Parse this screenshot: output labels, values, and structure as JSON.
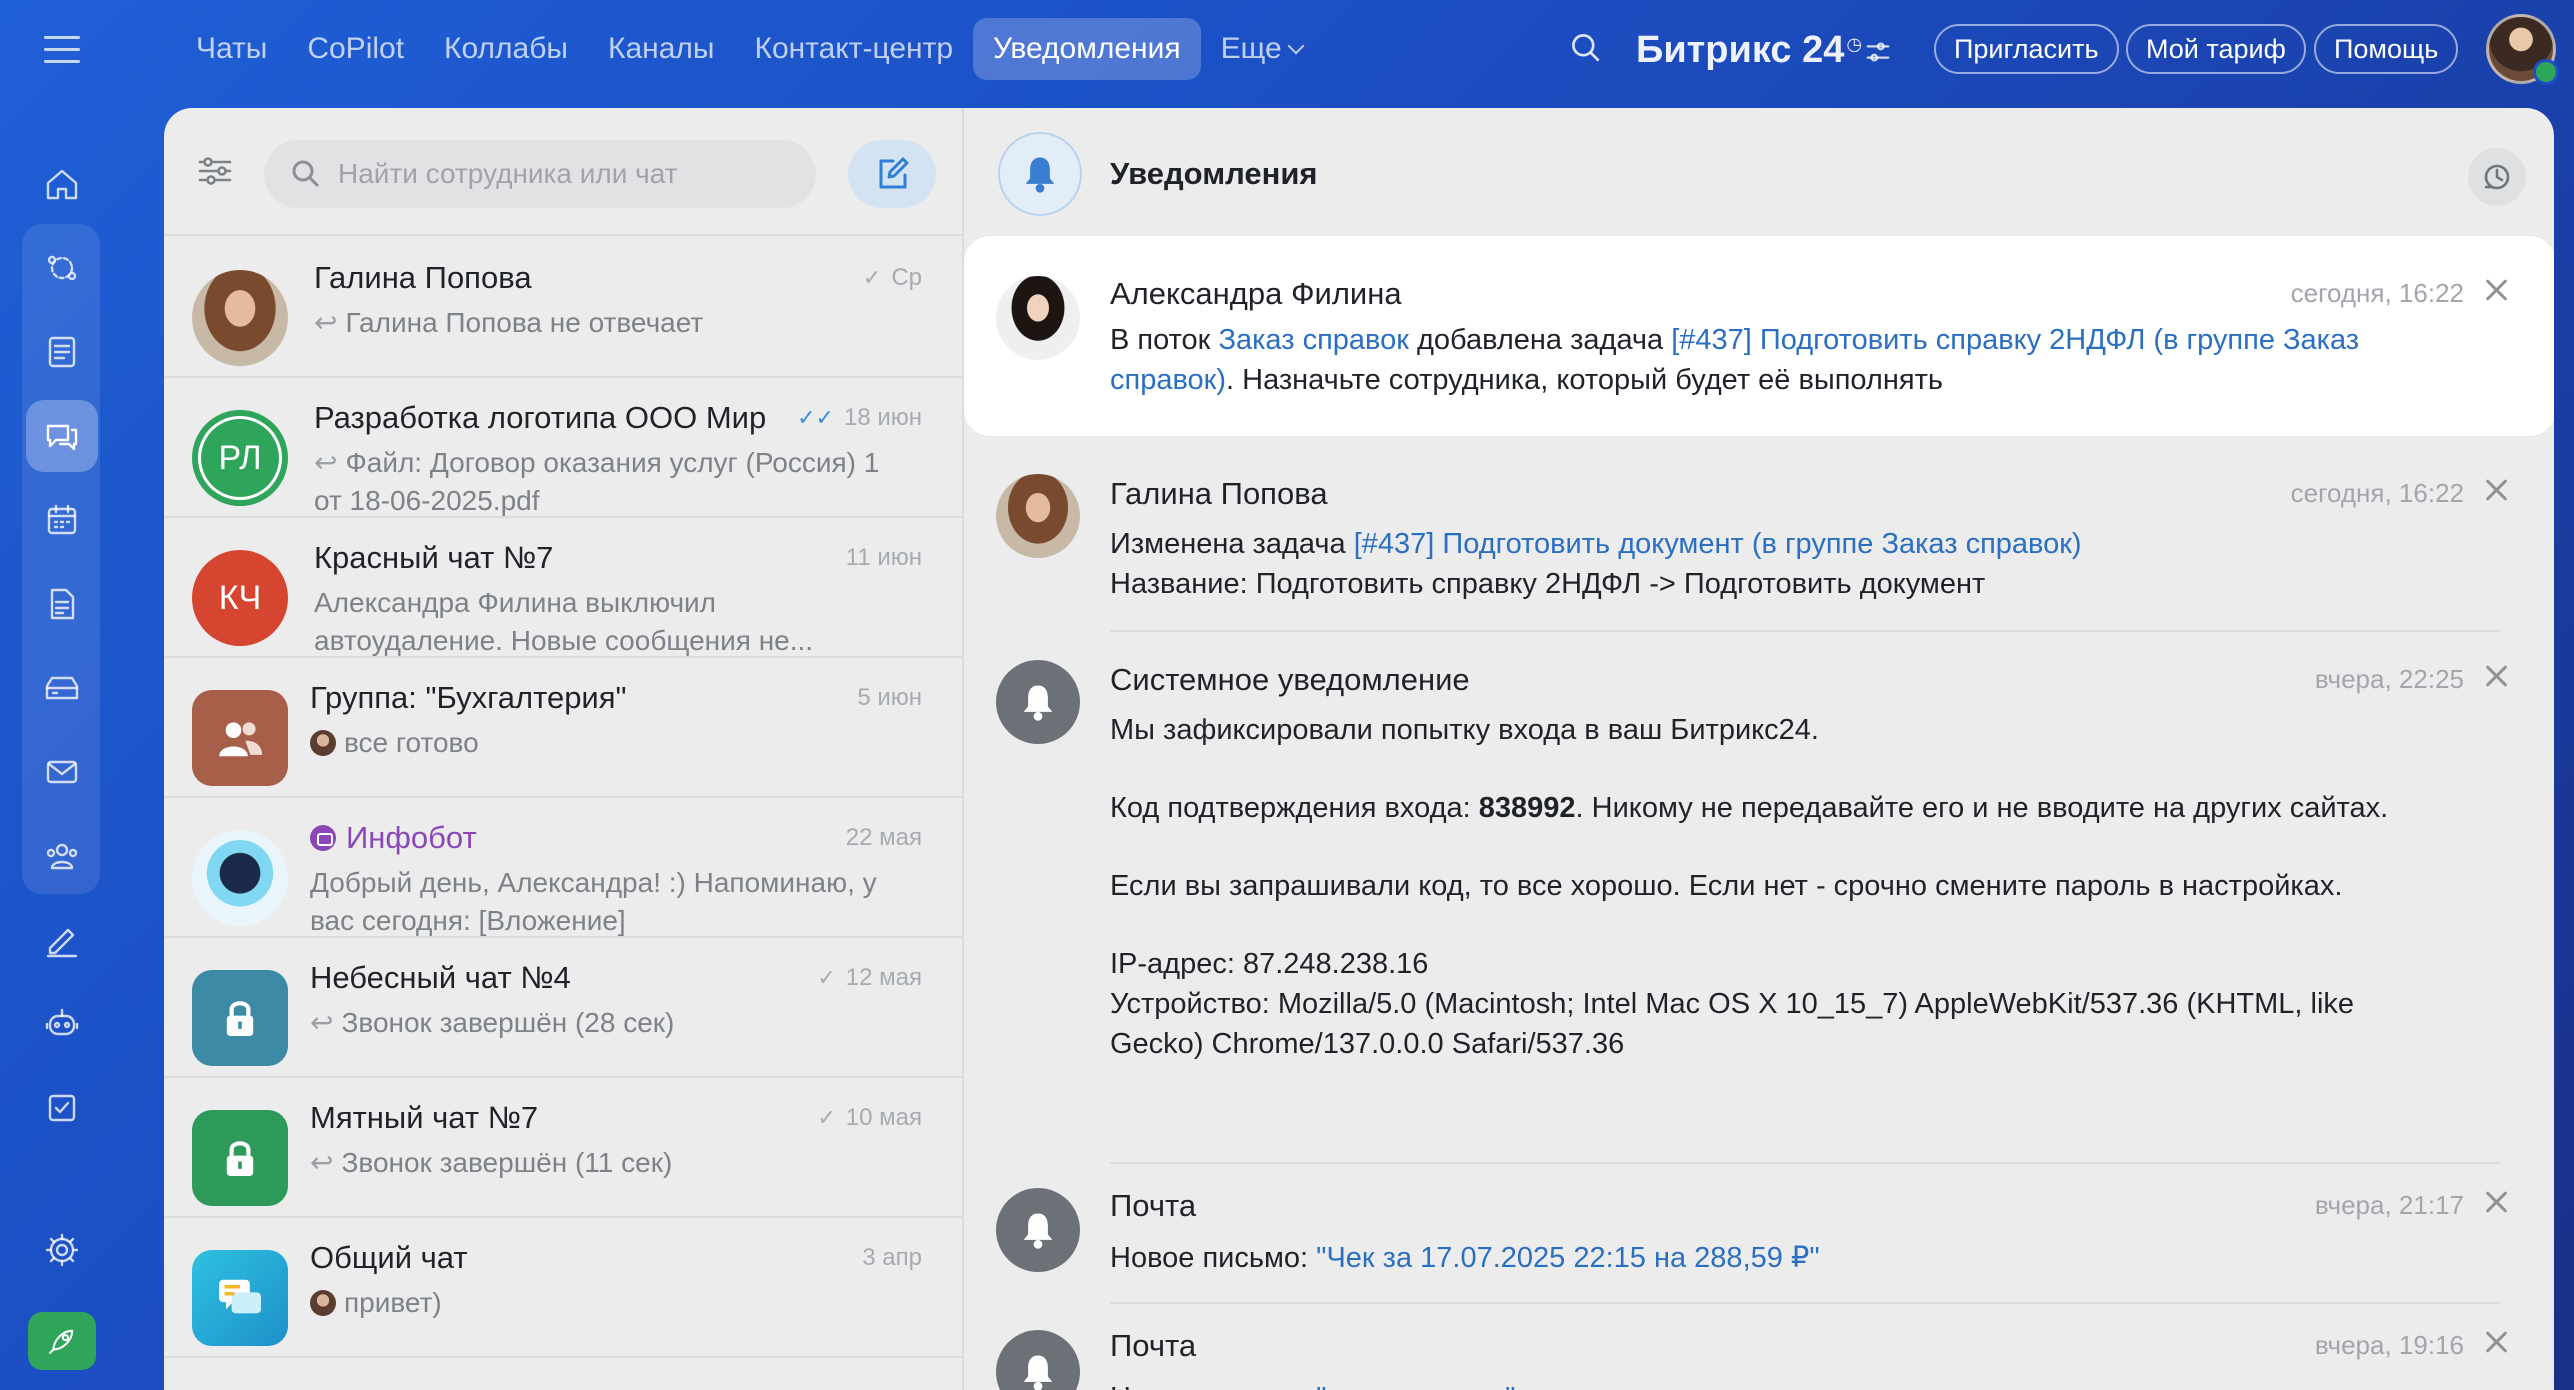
{
  "topnav": {
    "items": [
      "Чаты",
      "CoPilot",
      "Коллабы",
      "Каналы",
      "Контакт-центр",
      "Уведомления",
      "Еще"
    ],
    "active_index": 5,
    "brand": "Битрикс 24",
    "invite": "Пригласить",
    "tariff": "Мой тариф",
    "help": "Помощь"
  },
  "rail": {
    "icons": [
      "home-icon",
      "feed-icon",
      "tasks-icon",
      "chat-icon",
      "calendar-icon",
      "docs-icon",
      "crm-icon",
      "mail-icon",
      "team-icon",
      "sign-icon",
      "bot-icon",
      "checklist-icon"
    ],
    "active": "chat-icon",
    "accent": "#2fa45b"
  },
  "search": {
    "placeholder": "Найти сотрудника или чат"
  },
  "chats": [
    {
      "title": "Галина Попова",
      "date": "Ср",
      "check": "single",
      "preview": "Галина Попова не отвечает",
      "reply": true,
      "avatar_type": "photo"
    },
    {
      "title": "Разработка логотипа ООО Мир",
      "date": "18 июн",
      "check": "double",
      "preview": "Файл: Договор оказания услуг (Россия) 1 от 18-06-2025.pdf",
      "reply": true,
      "avatar_text": "РЛ",
      "avatar_color": "#2fa45b"
    },
    {
      "title": "Красный чат №7",
      "date": "11 июн",
      "preview": "Александра Филина выключил автоудаление. Новые сообщения не...",
      "avatar_text": "КЧ",
      "avatar_color": "#d6452f"
    },
    {
      "title": "Группа: \"Бухгалтерия\"",
      "date": "5 июн",
      "preview": "все готово",
      "mini_avatar": true,
      "avatar_color": "#a85f4a"
    },
    {
      "title": "Инфобот",
      "date": "22 мая",
      "preview": "Добрый день, Александра! :) Напоминаю, у вас сегодня: [Вложение]",
      "bot": true,
      "title_color": "#8b47b8"
    },
    {
      "title": "Небесный чат №4",
      "date": "12 мая",
      "check": "single",
      "preview": "Звонок завершён (28 сек)",
      "reply": true,
      "avatar_color": "#3c8aa6"
    },
    {
      "title": "Мятный чат №7",
      "date": "10 мая",
      "check": "single",
      "preview": "Звонок завершён (11 сек)",
      "reply": true,
      "avatar_color": "#2e9a5a"
    },
    {
      "title": "Общий чат",
      "date": "3 апр",
      "preview": "привет)",
      "mini_avatar": true,
      "avatar_color": "#2aa7cf"
    }
  ],
  "notifications_panel": {
    "title": "Уведомления",
    "items": [
      {
        "author": "Александра Филина",
        "time": "сегодня, 16:22",
        "text_1": "В поток ",
        "link_1": "Заказ справок",
        "text_2": " добавлена задача ",
        "link_2": "[#437] Подготовить справку 2НДФЛ (в группе Заказ справок)",
        "text_3": ". Назначьте сотрудника, который будет её выполнять"
      },
      {
        "author": "Галина Попова",
        "time": "сегодня, 16:22",
        "text_1": "Изменена задача ",
        "link_1": "[#437] Подготовить документ (в группе Заказ справок)",
        "line_2": "Название: Подготовить справку 2НДФЛ -> Подготовить документ"
      },
      {
        "author": "Системное уведомление",
        "time": "вчера, 22:25",
        "line_1": "Мы зафиксировали попытку входа в ваш Битрикс24.",
        "code_prefix": "Код подтверждения входа: ",
        "code": "838992",
        "code_suffix": ". Никому не передавайте его и не вводите на других сайтах.",
        "line_3": "Если вы запрашивали код, то все хорошо. Если нет - срочно смените пароль в настройках.",
        "ip": "IP-адрес: 87.248.238.16",
        "device": "Устройство: Mozilla/5.0 (Macintosh; Intel Mac OS X 10_15_7) AppleWebKit/537.36 (KHTML, like Gecko) Chrome/137.0.0.0 Safari/537.36"
      },
      {
        "author": "Почта",
        "time": "вчера, 21:17",
        "text_1": "Новое письмо: ",
        "link_1": "\"Чек за 17.07.2025 22:15 на 288,59 ₽\""
      },
      {
        "author": "Почта",
        "time": "вчера, 19:16",
        "text_1": "Новое письмо: ",
        "link_1": "\"гость в ленте\""
      }
    ]
  }
}
